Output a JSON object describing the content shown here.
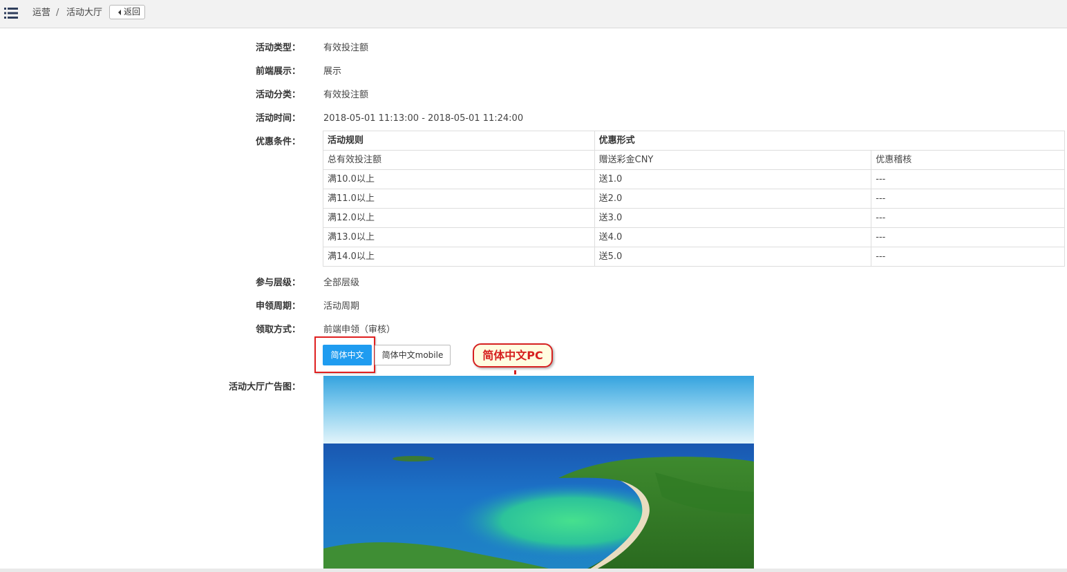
{
  "header": {
    "breadcrumb": [
      "运营",
      "活动大厅"
    ],
    "separator": "/",
    "back_label": "返回"
  },
  "fields": {
    "activity_type": {
      "label": "活动类型：",
      "value": "有效投注额"
    },
    "frontend_display": {
      "label": "前端展示：",
      "value": "展示"
    },
    "activity_category": {
      "label": "活动分类：",
      "value": "有效投注额"
    },
    "activity_time": {
      "label": "活动时间：",
      "value": "2018-05-01 11:13:00 - 2018-05-01 11:24:00"
    },
    "discount_conditions": {
      "label": "优惠条件："
    },
    "participation_level": {
      "label": "参与层级：",
      "value": "全部层级"
    },
    "claim_period": {
      "label": "申领周期：",
      "value": "活动周期"
    },
    "claim_method": {
      "label": "领取方式：",
      "value": "前端申领（审核）"
    },
    "banner": {
      "label": "活动大厅广告图："
    }
  },
  "promo_table": {
    "header": [
      "活动规则",
      "优惠形式"
    ],
    "subheader": [
      "总有效投注额",
      "赠送彩金CNY",
      "优惠稽核"
    ],
    "rows": [
      [
        "满10.0以上",
        "送1.0",
        "---"
      ],
      [
        "满11.0以上",
        "送2.0",
        "---"
      ],
      [
        "满12.0以上",
        "送3.0",
        "---"
      ],
      [
        "满13.0以上",
        "送4.0",
        "---"
      ],
      [
        "满14.0以上",
        "送5.0",
        "---"
      ]
    ]
  },
  "language_tabs": {
    "active": "简体中文",
    "inactive": "简体中文mobile"
  },
  "annotation": {
    "callout_text": "简体中文PC"
  },
  "colors": {
    "accent": "#1f9cf0",
    "annotation": "#d62020",
    "topbar": "#f2f2f2"
  },
  "icons": [
    "menu-icon",
    "caret-left-icon"
  ]
}
